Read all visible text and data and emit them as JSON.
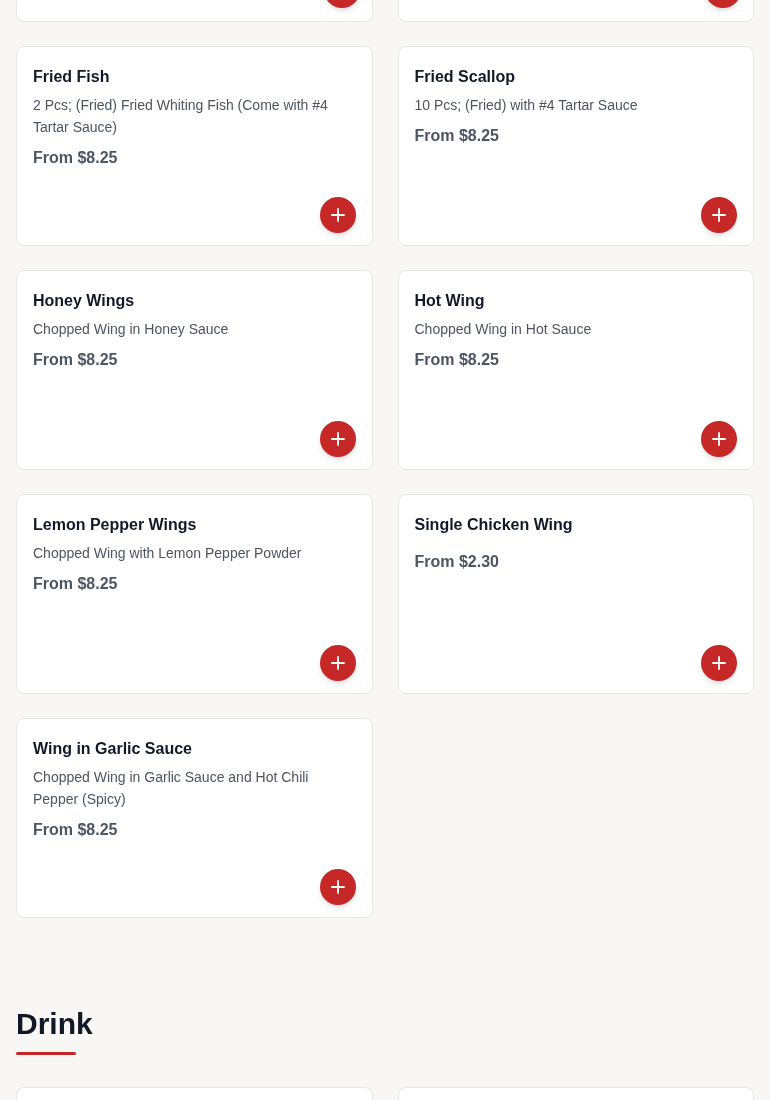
{
  "items": [
    {
      "kind": "cut_top"
    },
    {
      "kind": "cut_top"
    },
    {
      "kind": "full",
      "name": "Fried Fish",
      "description": "2 Pcs; (Fried) Fried Whiting Fish (Come with #4 Tartar Sauce)",
      "price": "From $8.25"
    },
    {
      "kind": "full",
      "name": "Fried Scallop",
      "description": "10 Pcs; (Fried) with #4 Tartar Sauce",
      "price": "From $8.25"
    },
    {
      "kind": "full",
      "name": "Honey Wings",
      "description": "Chopped Wing in Honey Sauce",
      "price": "From $8.25"
    },
    {
      "kind": "full",
      "name": "Hot Wing",
      "description": "Chopped Wing in Hot Sauce",
      "price": "From $8.25"
    },
    {
      "kind": "full",
      "name": "Lemon Pepper Wings",
      "description": "Chopped Wing with Lemon Pepper Powder",
      "price": "From $8.25"
    },
    {
      "kind": "full",
      "name": "Single Chicken Wing",
      "price": "From $2.30"
    },
    {
      "kind": "full",
      "name": "Wing in Garlic Sauce",
      "description": "Chopped Wing in Garlic Sauce and Hot Chili Pepper (Spicy)",
      "price": "From $8.25"
    }
  ],
  "next_section": {
    "title": "Drink",
    "items": [
      {
        "kind": "cut_bottom"
      },
      {
        "kind": "cut_bottom"
      }
    ]
  }
}
